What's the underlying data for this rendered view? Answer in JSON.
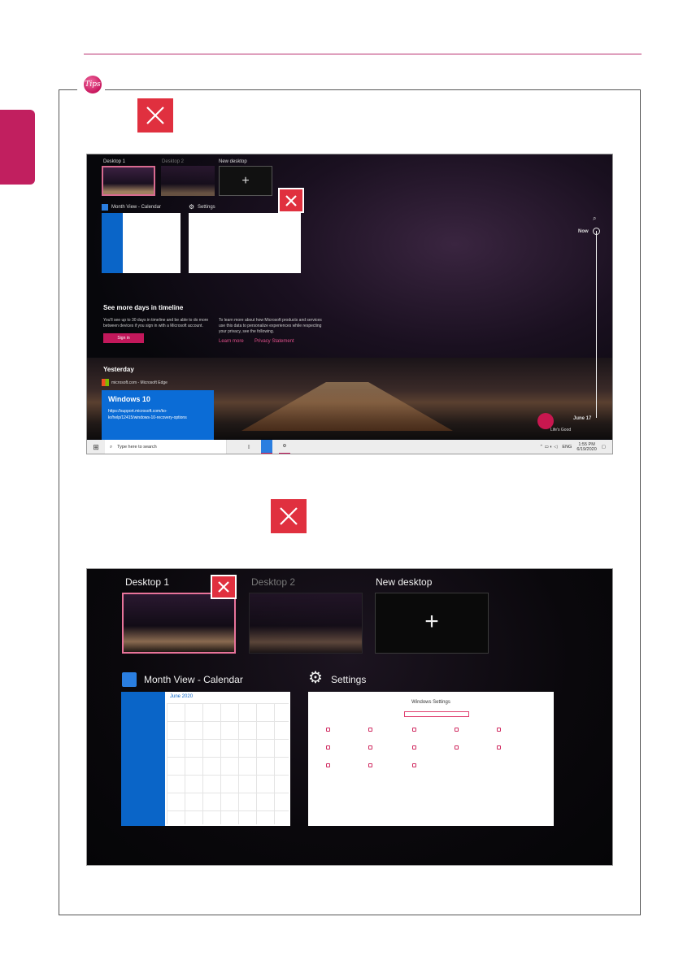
{
  "tips_icon_text": "Tips",
  "colors": {
    "accent": "#c11f5f",
    "close_button": "#e0303f",
    "windows_blue": "#0b6cd6"
  },
  "screenshot1": {
    "desktops": [
      "Desktop 1",
      "Desktop 2",
      "New desktop"
    ],
    "new_desktop_plus": "+",
    "windows": [
      {
        "title": "Month View - Calendar"
      },
      {
        "title": "Settings"
      }
    ],
    "timeline_heading": "See more days in timeline",
    "timeline_text_left": "You'll see up to 30 days in timeline and be able to do more between devices if you sign in with a Microsoft account.",
    "timeline_text_right": "To learn more about how Microsoft products and services use this data to personalize experiences while respecting your privacy, see the following.",
    "sign_in": "Sign in",
    "learn_more": "Learn more",
    "privacy": "Privacy Statement",
    "yesterday": "Yesterday",
    "edge_source": "microsoft.com - Microsoft Edge",
    "card_title": "Windows 10",
    "card_url": "https://support.microsoft.com/ko-kr/help/12415/windows-10-recovery-options",
    "now_label": "Now",
    "june_label": "June 17",
    "lg_tagline": "Life's Good",
    "taskbar": {
      "search_placeholder": "Type here to search",
      "lang": "ENG",
      "time": "1:55 PM",
      "date": "6/19/2020"
    }
  },
  "screenshot2": {
    "desktops": [
      "Desktop 1",
      "Desktop 2",
      "New desktop"
    ],
    "new_desktop_plus": "+",
    "windows": [
      {
        "title": "Month View - Calendar",
        "month": "June 2020"
      },
      {
        "title": "Settings",
        "heading": "Windows Settings"
      }
    ]
  }
}
